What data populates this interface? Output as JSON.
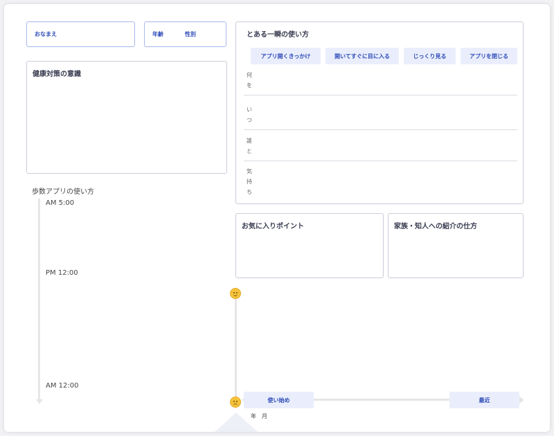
{
  "profile": {
    "name_label": "おなまえ",
    "age_label": "年齢",
    "gender_label": "性別"
  },
  "health": {
    "title": "健康対策の意識"
  },
  "one_scene": {
    "title": "とある一瞬の使い方",
    "tabs": [
      "アプリ開くきっかけ",
      "開いてすぐに目に入る",
      "じっくり見る",
      "アプリを閉じる"
    ],
    "rows": [
      "何を",
      "いつ",
      "誰と",
      "気持ち"
    ]
  },
  "step_app": {
    "title": "歩数アプリの使い方",
    "times": [
      "AM 5:00",
      "PM 12:00",
      "AM 12:00"
    ]
  },
  "favorite": {
    "title": "お気に入りポイント"
  },
  "referral": {
    "title": "家族・知人への紹介の仕方"
  },
  "timeline": {
    "start_label": "使い始め",
    "end_label": "最近",
    "date_label": "年　月",
    "happy_icon": "smile-emoji-icon",
    "sad_icon": "frown-emoji-icon"
  }
}
